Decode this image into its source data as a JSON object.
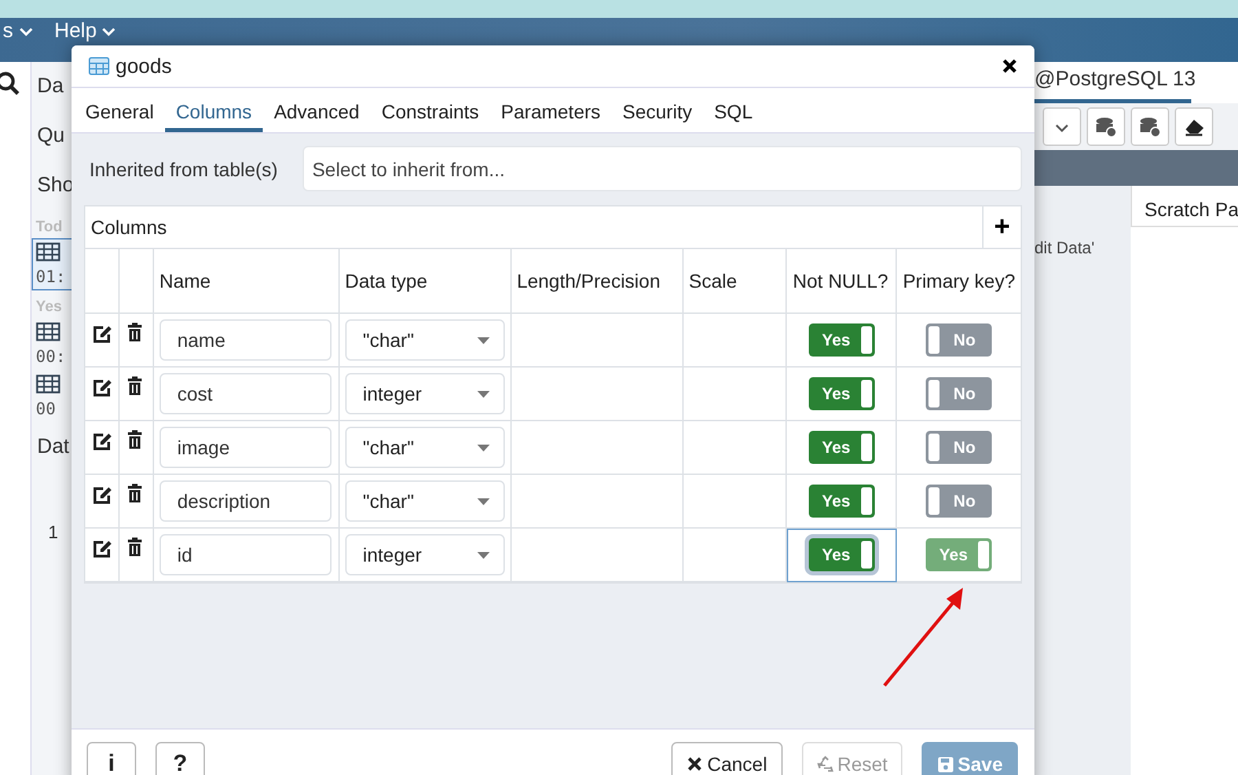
{
  "menu": [
    {
      "label": "s"
    },
    {
      "label": "Help"
    }
  ],
  "left_panel": {
    "items": [
      {
        "label": "Da"
      },
      {
        "label": "Qu"
      },
      {
        "label": "Sho"
      },
      {
        "label": "Tod",
        "kind": "heading"
      },
      {
        "label": "01:",
        "kind": "entry",
        "selected": true
      },
      {
        "label": "Yes",
        "kind": "heading"
      },
      {
        "label": "00:",
        "kind": "entry",
        "selected": false
      },
      {
        "label": "00",
        "kind": "entry",
        "selected": false
      },
      {
        "label": "Dat"
      },
      {
        "label": "1",
        "kind": "row"
      }
    ]
  },
  "right_panel": {
    "tab": "@PostgreSQL 13",
    "header": "Scratch Pa",
    "note": "dit Data'"
  },
  "dialog": {
    "title": "goods",
    "tabs": [
      {
        "label": "General",
        "selected": false
      },
      {
        "label": "Columns",
        "selected": true
      },
      {
        "label": "Advanced",
        "selected": false
      },
      {
        "label": "Constraints",
        "selected": false
      },
      {
        "label": "Parameters",
        "selected": false
      },
      {
        "label": "Security",
        "selected": false
      },
      {
        "label": "SQL",
        "selected": false
      }
    ],
    "inherit": {
      "label": "Inherited from table(s)",
      "placeholder": "Select to inherit from..."
    },
    "table": {
      "title": "Columns",
      "add": "+",
      "columns": [
        "Name",
        "Data type",
        "Length/Precision",
        "Scale",
        "Not NULL?",
        "Primary key?"
      ],
      "rows": [
        {
          "name": "name",
          "type": "\"char\"",
          "not_null": {
            "label": "Yes",
            "on": true,
            "focused": false,
            "dimmed": false
          },
          "primary_key": {
            "label": "No",
            "on": false,
            "focused": false,
            "dimmed": false
          }
        },
        {
          "name": "cost",
          "type": "integer",
          "not_null": {
            "label": "Yes",
            "on": true,
            "focused": false,
            "dimmed": false
          },
          "primary_key": {
            "label": "No",
            "on": false,
            "focused": false,
            "dimmed": false
          }
        },
        {
          "name": "image",
          "type": "\"char\"",
          "not_null": {
            "label": "Yes",
            "on": true,
            "focused": false,
            "dimmed": false
          },
          "primary_key": {
            "label": "No",
            "on": false,
            "focused": false,
            "dimmed": false
          }
        },
        {
          "name": "description",
          "type": "\"char\"",
          "not_null": {
            "label": "Yes",
            "on": true,
            "focused": false,
            "dimmed": false
          },
          "primary_key": {
            "label": "No",
            "on": false,
            "focused": false,
            "dimmed": false
          }
        },
        {
          "name": "id",
          "type": "integer",
          "not_null": {
            "label": "Yes",
            "on": true,
            "focused": true,
            "dimmed": false
          },
          "primary_key": {
            "label": "Yes",
            "on": true,
            "focused": false,
            "dimmed": true
          }
        }
      ]
    },
    "footer": {
      "left": [
        {
          "label": "i"
        },
        {
          "label": "?"
        }
      ],
      "right": [
        {
          "label": "Cancel",
          "kind": "cancel",
          "disabled": false
        },
        {
          "label": "Reset",
          "kind": "reset",
          "disabled": true
        },
        {
          "label": "Save",
          "kind": "save",
          "disabled": true
        }
      ]
    }
  }
}
